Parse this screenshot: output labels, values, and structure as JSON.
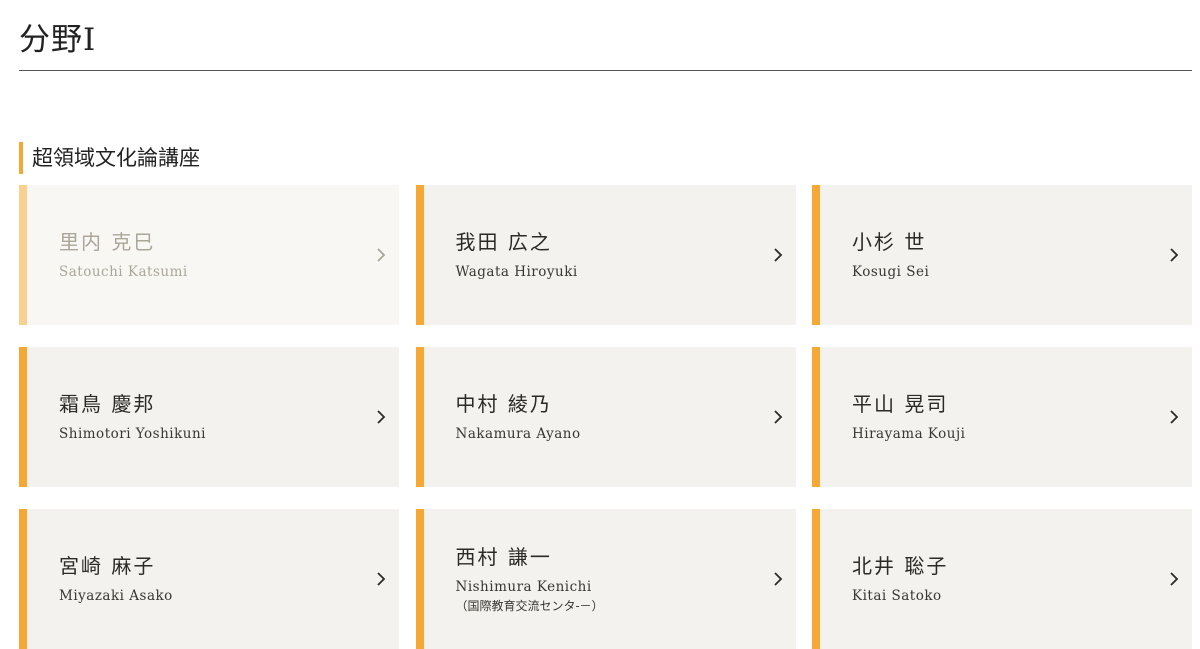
{
  "page": {
    "title": "分野I"
  },
  "section": {
    "heading": "超領域文化論講座"
  },
  "colors": {
    "accent": "#f5a833",
    "accent_faded": "#f8d08f",
    "card_bg": "#f3f2ee",
    "rule": "#555555"
  },
  "people": [
    {
      "name_jp": "里内 克巳",
      "name_en": "Satouchi Katsumi",
      "note": "",
      "state": "faded"
    },
    {
      "name_jp": "我田 広之",
      "name_en": "Wagata Hiroyuki",
      "note": "",
      "state": "normal"
    },
    {
      "name_jp": "小杉 世",
      "name_en": "Kosugi Sei",
      "note": "",
      "state": "normal"
    },
    {
      "name_jp": "霜鳥 慶邦",
      "name_en": "Shimotori Yoshikuni",
      "note": "",
      "state": "normal"
    },
    {
      "name_jp": "中村 綾乃",
      "name_en": "Nakamura Ayano",
      "note": "",
      "state": "normal"
    },
    {
      "name_jp": "平山 晃司",
      "name_en": "Hirayama Kouji",
      "note": "",
      "state": "normal"
    },
    {
      "name_jp": "宮崎 麻子",
      "name_en": "Miyazaki Asako",
      "note": "",
      "state": "normal"
    },
    {
      "name_jp": "西村 謙一",
      "name_en": "Nishimura Kenichi",
      "note": "（国際教育交流センタ-－）",
      "state": "normal"
    },
    {
      "name_jp": "北井 聡子",
      "name_en": "Kitai Satoko",
      "note": "",
      "state": "normal"
    }
  ],
  "icons": {
    "card_arrow": "chevron-right-icon"
  }
}
